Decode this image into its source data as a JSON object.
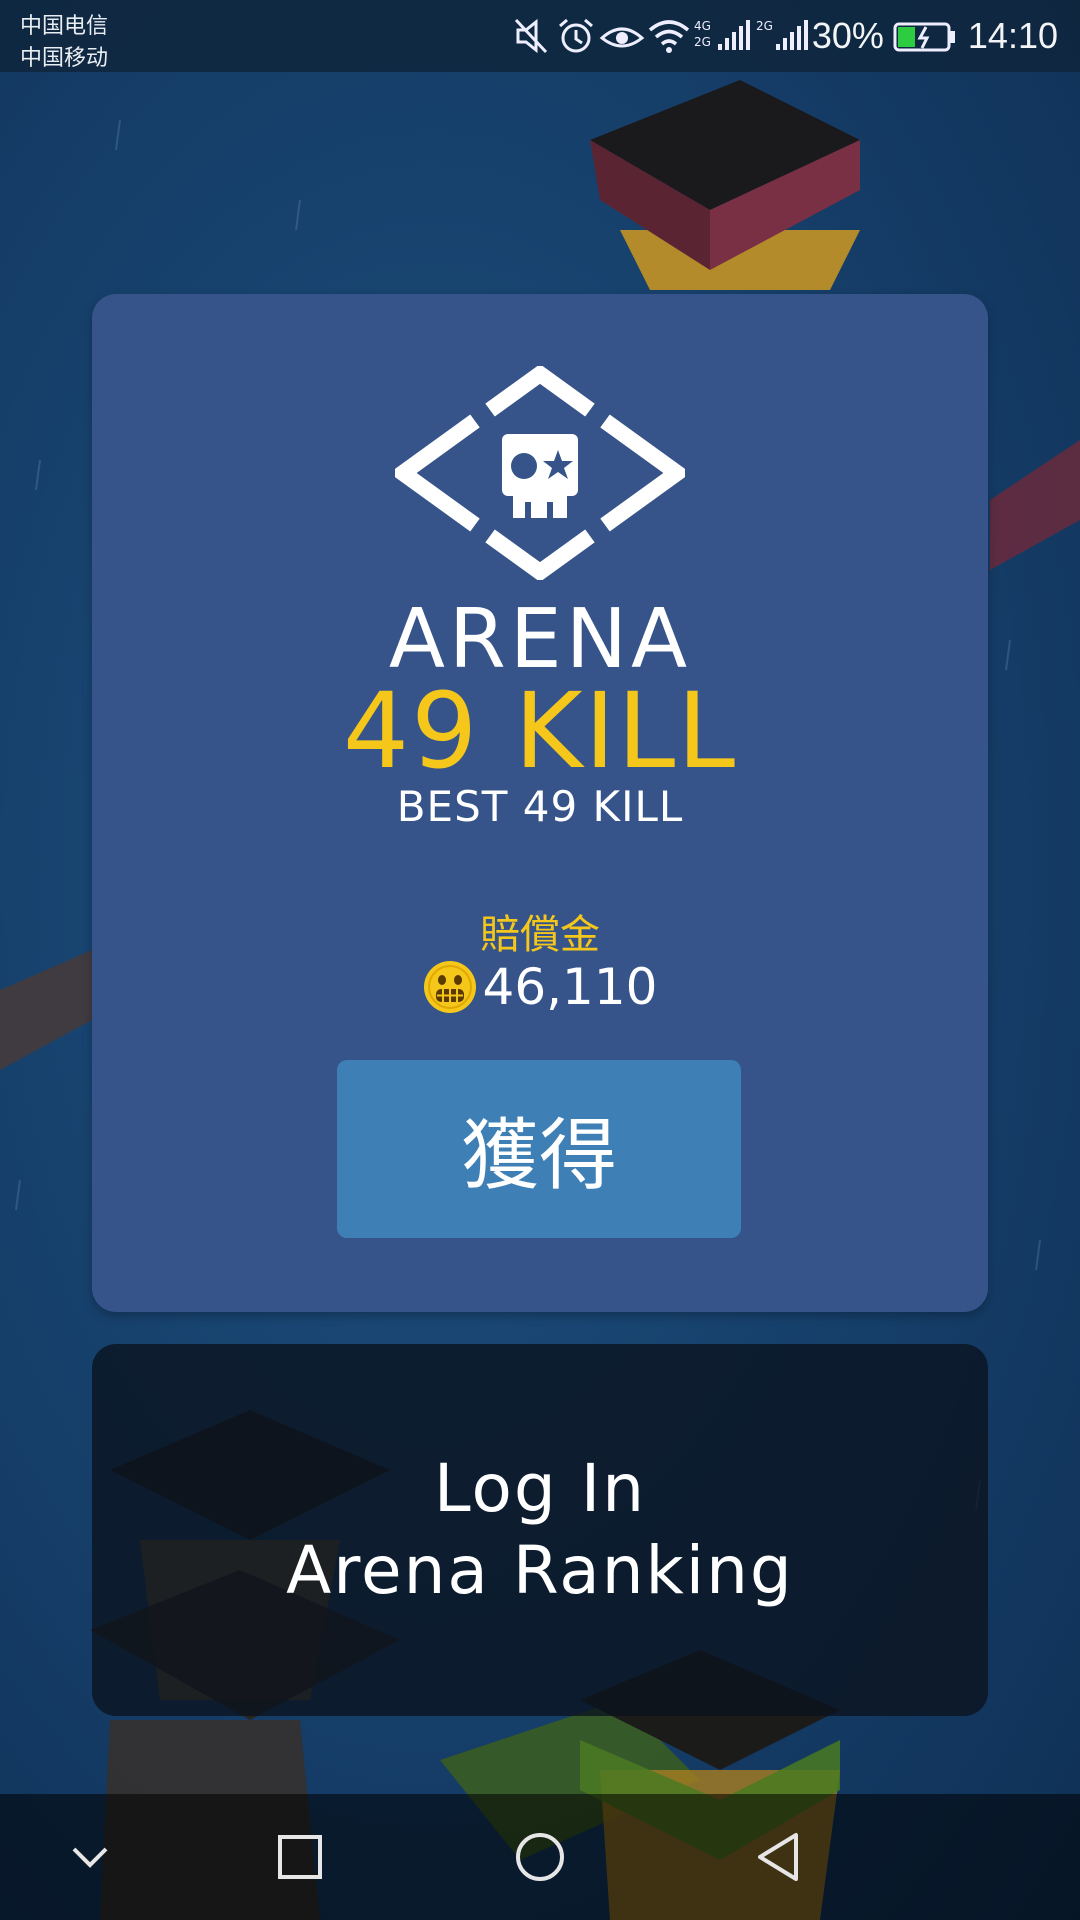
{
  "status_bar": {
    "carrier_1": "中国电信",
    "carrier_2": "中国移动",
    "battery_percent": "30%",
    "time": "14:10",
    "network_1": "4G 2G",
    "network_2": "2G",
    "icons": [
      "mute-icon",
      "alarm-icon",
      "eye-comfort-icon",
      "wifi-icon",
      "signal-icon",
      "battery-charging-icon"
    ]
  },
  "result_card": {
    "mode": "ARENA",
    "kill_count": "49 KILL",
    "best": "BEST 49 KILL",
    "reward_label": "賠償金",
    "reward_amount": "46,110",
    "claim_button": "獲得",
    "logo_icon": "skull-star-diamond-icon",
    "coin_icon": "grinning-coin-icon"
  },
  "login_card": {
    "line1": "Log In",
    "line2": "Arena Ranking"
  },
  "nav_bar": {
    "buttons": [
      "collapse-icon",
      "recents-icon",
      "home-icon",
      "back-icon"
    ]
  },
  "colors": {
    "card": "#365489",
    "accent_yellow": "#f5c71a",
    "button": "#3e7fb5",
    "background": "#17426e"
  }
}
